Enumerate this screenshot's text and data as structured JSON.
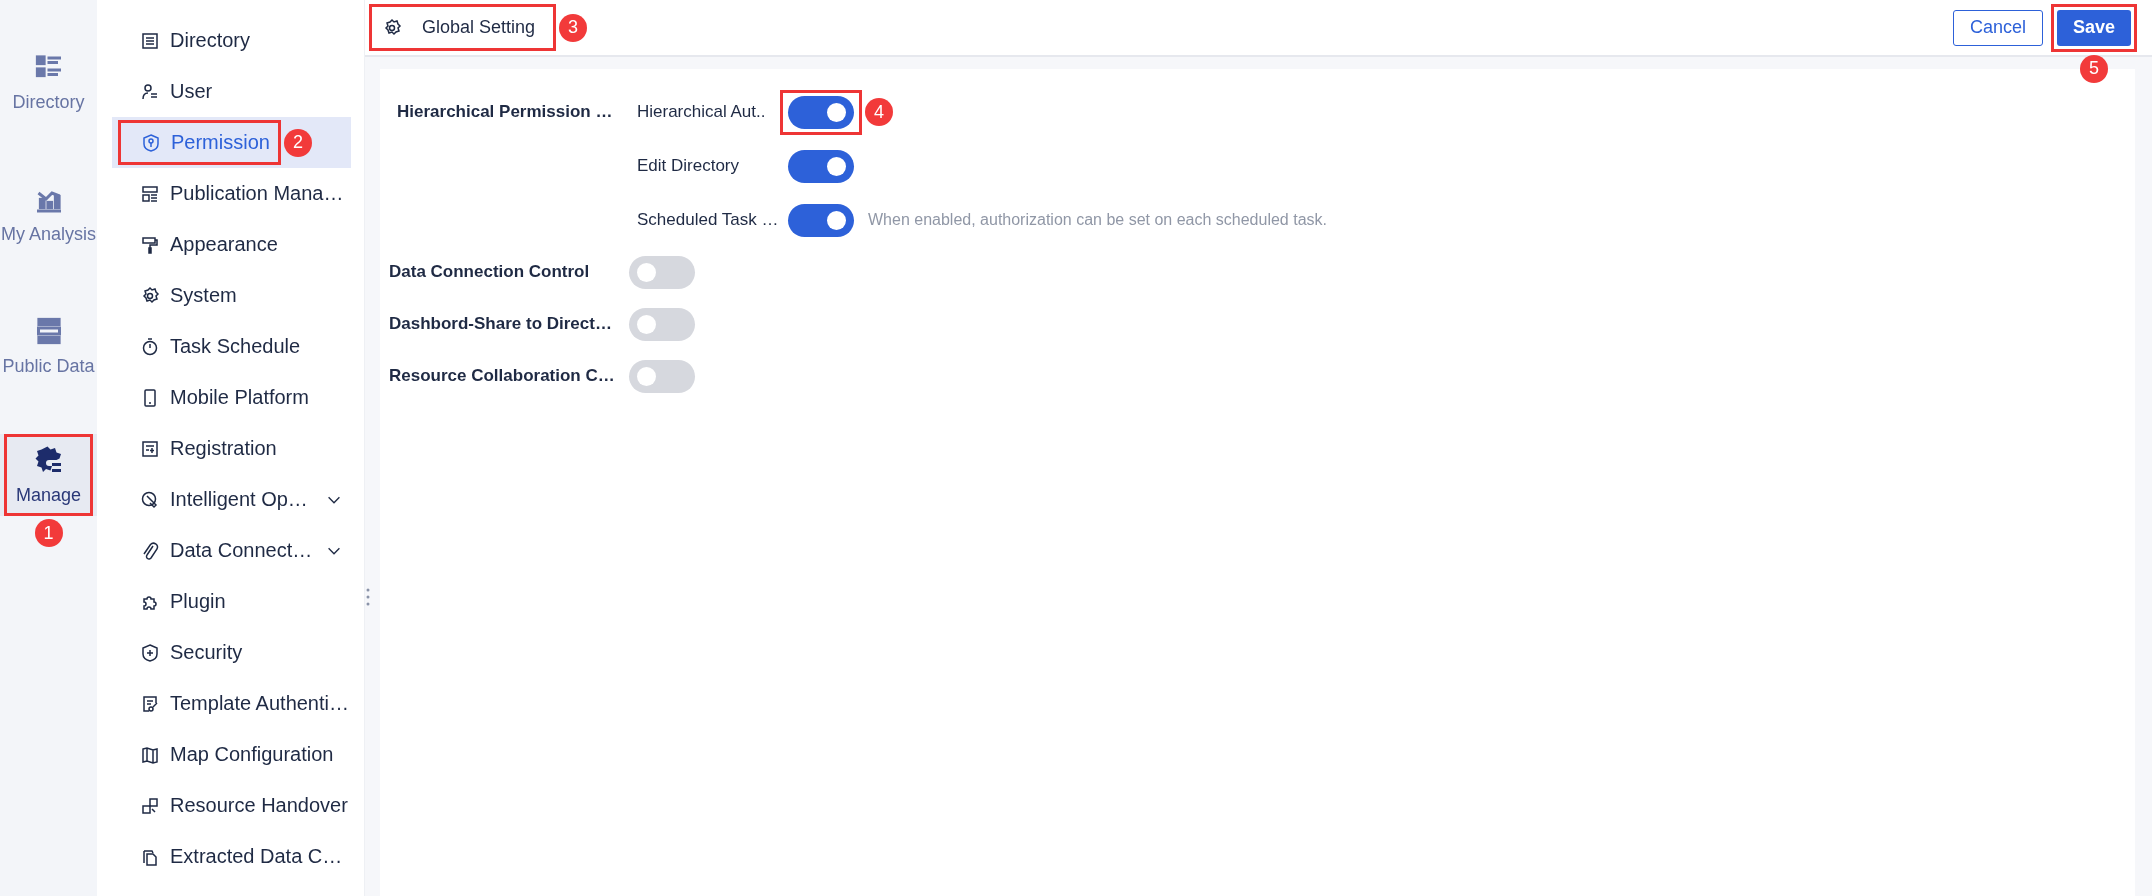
{
  "rail": [
    {
      "label": "Directory",
      "selected": false
    },
    {
      "label": "My Analysis",
      "selected": false
    },
    {
      "label": "Public Data",
      "selected": false
    },
    {
      "label": "Manage",
      "selected": true,
      "callout": "1"
    }
  ],
  "sidebar": {
    "items": [
      {
        "label": "Directory",
        "selected": false
      },
      {
        "label": "User",
        "selected": false
      },
      {
        "label": "Permission",
        "selected": true,
        "callout": "2"
      },
      {
        "label": "Publication Mana…",
        "selected": false
      },
      {
        "label": "Appearance",
        "selected": false
      },
      {
        "label": "System",
        "selected": false
      },
      {
        "label": "Task Schedule",
        "selected": false
      },
      {
        "label": "Mobile Platform",
        "selected": false
      },
      {
        "label": "Registration",
        "selected": false
      },
      {
        "label": "Intelligent Op…",
        "selected": false,
        "expandable": true
      },
      {
        "label": "Data Connect…",
        "selected": false,
        "expandable": true
      },
      {
        "label": "Plugin",
        "selected": false
      },
      {
        "label": "Security",
        "selected": false
      },
      {
        "label": "Template Authenti…",
        "selected": false
      },
      {
        "label": "Map Configuration",
        "selected": false
      },
      {
        "label": "Resource Handover",
        "selected": false
      },
      {
        "label": "Extracted Data C…",
        "selected": false
      }
    ]
  },
  "header": {
    "title": "Global Setting",
    "callout": "3"
  },
  "buttons": [
    {
      "label": "Cancel",
      "kind": "secondary"
    },
    {
      "label": "Save",
      "kind": "primary",
      "callout": "5"
    }
  ],
  "settings": [
    {
      "label": "Hierarchical Permission …",
      "children": [
        {
          "label": "Hierarchical Aut..",
          "on": true,
          "callout": "4"
        },
        {
          "label": "Edit Directory",
          "on": true
        },
        {
          "label": "Scheduled Task …",
          "on": true,
          "note": "When enabled, authorization can be set on each scheduled task."
        }
      ]
    },
    {
      "label": "Data Connection Control",
      "on": false
    },
    {
      "label": "Dashbord-Share to Direct…",
      "on": false
    },
    {
      "label": "Resource Collaboration C…",
      "on": false
    }
  ]
}
